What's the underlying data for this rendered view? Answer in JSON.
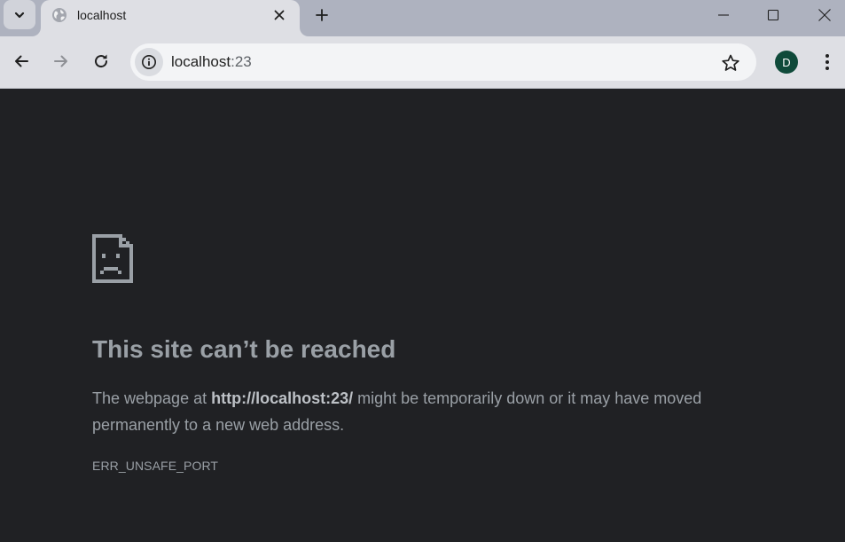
{
  "tab": {
    "title": "localhost",
    "favicon": "globe-icon"
  },
  "toolbar": {
    "url_host": "localhost",
    "url_port": ":23"
  },
  "profile": {
    "initial": "D",
    "color": "#0f4a3a"
  },
  "error": {
    "title": "This site can’t be reached",
    "desc_prefix": "The webpage at ",
    "desc_url": "http://localhost:23/",
    "desc_suffix": " might be temporarily down or it may have moved permanently to a new web address.",
    "code": "ERR_UNSAFE_PORT"
  },
  "colors": {
    "tabstrip": "#aeb2bf",
    "toolbar": "#dedfe4",
    "content_bg": "#202124",
    "text": "#9aa0a6"
  }
}
